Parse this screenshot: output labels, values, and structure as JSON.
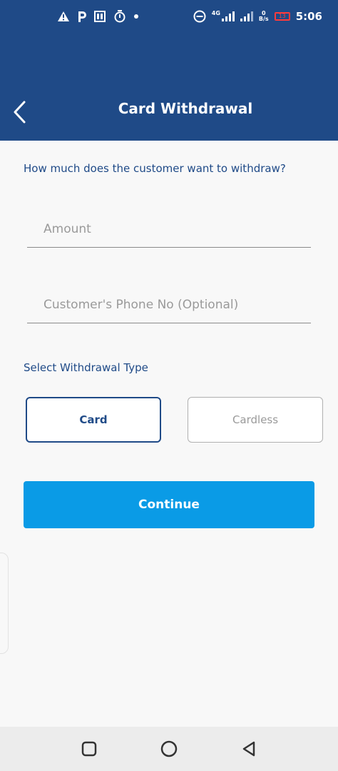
{
  "status_bar": {
    "time": "5:06",
    "network_type": "4G",
    "data_rate_value": "0",
    "data_rate_unit": "B/s",
    "battery_level": "13",
    "left_icons": [
      "warning-icon",
      "parking-icon",
      "cast-icon",
      "stopwatch-icon",
      "dot-icon"
    ],
    "right_icons": [
      "dnd-icon",
      "signal-icon",
      "signal-icon",
      "battery-icon"
    ],
    "battery_color": "#ff3b3b"
  },
  "header": {
    "title": "Card Withdrawal",
    "back_icon": "chevron-left-icon",
    "background_color": "#1f4a87"
  },
  "form": {
    "question": "How much does the customer want to withdraw?",
    "amount_placeholder": "Amount",
    "amount_value": "",
    "phone_placeholder": "Customer's Phone No (Optional)",
    "phone_value": "",
    "withdrawal_type_label": "Select Withdrawal Type",
    "types": [
      {
        "label": "Card",
        "selected": true
      },
      {
        "label": "Cardless",
        "selected": false
      }
    ],
    "continue_label": "Continue",
    "accent_color": "#0a9be6"
  },
  "nav_bar": {
    "buttons": [
      "recents-icon",
      "home-icon",
      "back-triangle-icon"
    ]
  }
}
